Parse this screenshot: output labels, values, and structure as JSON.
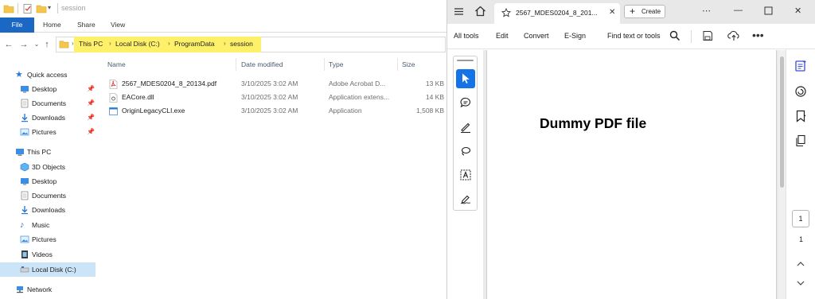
{
  "explorer": {
    "title": "session",
    "ribbon_tabs": [
      "File",
      "Home",
      "Share",
      "View"
    ],
    "breadcrumb": [
      "This PC",
      "Local Disk (C:)",
      "ProgramData",
      "session"
    ],
    "nav": {
      "quick_access": "Quick access",
      "quick_items": [
        "Desktop",
        "Documents",
        "Downloads",
        "Pictures"
      ],
      "this_pc": "This PC",
      "pc_items": [
        "3D Objects",
        "Desktop",
        "Documents",
        "Downloads",
        "Music",
        "Pictures",
        "Videos",
        "Local Disk (C:)"
      ],
      "network": "Network"
    },
    "columns": [
      "Name",
      "Date modified",
      "Type",
      "Size"
    ],
    "files": [
      {
        "name": "2567_MDES0204_8_20134.pdf",
        "date": "3/10/2025 3:02 AM",
        "type": "Adobe Acrobat D...",
        "size": "13 KB",
        "icon": "pdf-file-icon"
      },
      {
        "name": "EACore.dll",
        "date": "3/10/2025 3:02 AM",
        "type": "Application extens...",
        "size": "14 KB",
        "icon": "dll-file-icon"
      },
      {
        "name": "OriginLegacyCLI.exe",
        "date": "3/10/2025 3:02 AM",
        "type": "Application",
        "size": "1,508 KB",
        "icon": "exe-file-icon"
      }
    ],
    "colors": {
      "file_tab": "#1a67c4",
      "breadcrumb_highlight": "#fff06a",
      "selected_nav": "#cce4f7"
    }
  },
  "acrobat": {
    "tab_title": "2567_MDES0204_8_201...",
    "create_label": "Create",
    "menu": [
      "All tools",
      "Edit",
      "Convert",
      "E-Sign"
    ],
    "find_label": "Find text or tools",
    "document_text": "Dummy PDF file",
    "page_current": "1",
    "page_total": "1",
    "tools": [
      "select-icon",
      "comment-icon",
      "highlight-pen-icon",
      "lasso-draw-icon",
      "text-recognize-icon",
      "sign-pen-icon"
    ],
    "colors": {
      "accent": "#1473e6",
      "right_panel_accent": "#3b4dd1"
    }
  }
}
